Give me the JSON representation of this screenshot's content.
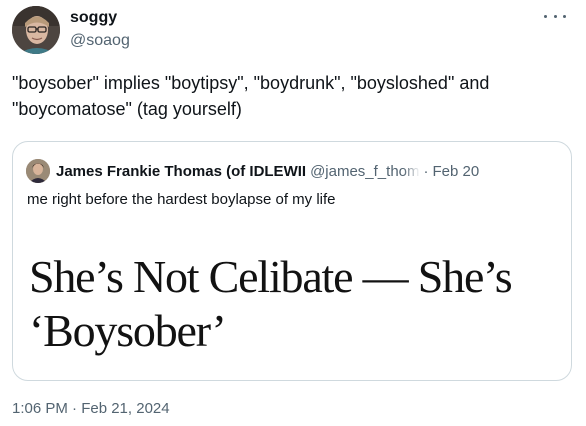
{
  "post": {
    "author": {
      "display_name": "soggy",
      "handle": "@soaog",
      "avatar": "profile-photo"
    },
    "more_icon": "ellipsis-icon",
    "text": "\"boysober\" implies \"boytipsy\", \"boydrunk\", \"boysloshed\" and \"boycomatose\" (tag yourself)",
    "timestamp": "1:06 PM · Feb 21, 2024"
  },
  "quote": {
    "author": {
      "display_name": "James Frankie Thomas (of IDLEWII",
      "handle": "@james_f_thom",
      "avatar": "profile-photo"
    },
    "separator": "·",
    "date": "Feb 20",
    "text": "me right before the hardest boylapse of my life",
    "headline_line1": "She’s Not Celibate — She’s",
    "headline_line2": "‘Boysober’"
  },
  "colors": {
    "primary_text": "#0f1419",
    "secondary_text": "#536471",
    "border": "#cfd9de"
  }
}
